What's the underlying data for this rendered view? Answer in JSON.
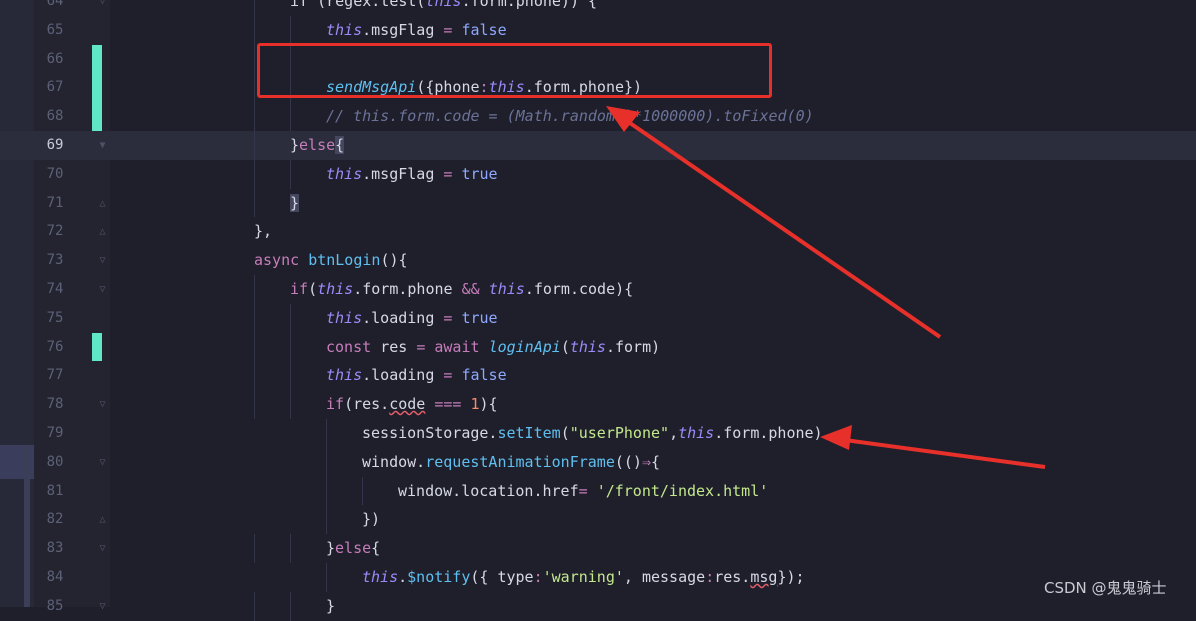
{
  "editor": {
    "current_line": 69,
    "lines": [
      {
        "no": "64",
        "segments": [
          {
            "t": "if (regex.test(",
            "c": "prop"
          },
          {
            "t": "this",
            "c": "this"
          },
          {
            "t": ".form.phone)) {",
            "c": "prop"
          }
        ]
      },
      {
        "no": "65",
        "segments": [
          {
            "t": "this",
            "c": "this"
          },
          {
            "t": ".msgFlag ",
            "c": "prop"
          },
          {
            "t": "=",
            "c": "op"
          },
          {
            "t": " false",
            "c": "bool"
          }
        ]
      },
      {
        "no": "66",
        "segments": []
      },
      {
        "no": "67",
        "segments": [
          {
            "t": "sendMsgApi",
            "c": "fn-it"
          },
          {
            "t": "({phone",
            "c": "prop"
          },
          {
            "t": ":",
            "c": "op"
          },
          {
            "t": "this",
            "c": "this"
          },
          {
            "t": ".form.phone})",
            "c": "prop"
          }
        ]
      },
      {
        "no": "68",
        "segments": [
          {
            "t": "// this.form.code = (Math.random()*1000000).toFixed(0)",
            "c": "comment"
          }
        ]
      },
      {
        "no": "69",
        "segments": [
          {
            "t": "}",
            "c": "prop"
          },
          {
            "t": "else",
            "c": "kw"
          },
          {
            "t": "{",
            "c": "prop brace-hl"
          }
        ]
      },
      {
        "no": "70",
        "segments": [
          {
            "t": "this",
            "c": "this"
          },
          {
            "t": ".msgFlag ",
            "c": "prop"
          },
          {
            "t": "=",
            "c": "op"
          },
          {
            "t": " true",
            "c": "bool"
          }
        ]
      },
      {
        "no": "71",
        "segments": [
          {
            "t": "}",
            "c": "prop brace-hl"
          }
        ]
      },
      {
        "no": "72",
        "segments": [
          {
            "t": "},",
            "c": "prop"
          }
        ]
      },
      {
        "no": "73",
        "segments": [
          {
            "t": "async ",
            "c": "kw"
          },
          {
            "t": "btnLogin",
            "c": "fn"
          },
          {
            "t": "(){",
            "c": "prop"
          }
        ]
      },
      {
        "no": "74",
        "segments": [
          {
            "t": "if",
            "c": "kw"
          },
          {
            "t": "(",
            "c": "prop"
          },
          {
            "t": "this",
            "c": "this"
          },
          {
            "t": ".form.phone ",
            "c": "prop"
          },
          {
            "t": "&&",
            "c": "op"
          },
          {
            "t": " ",
            "c": "prop"
          },
          {
            "t": "this",
            "c": "this"
          },
          {
            "t": ".form.code){",
            "c": "prop"
          }
        ]
      },
      {
        "no": "75",
        "segments": [
          {
            "t": "this",
            "c": "this"
          },
          {
            "t": ".loading ",
            "c": "prop"
          },
          {
            "t": "=",
            "c": "op"
          },
          {
            "t": " true",
            "c": "bool"
          }
        ]
      },
      {
        "no": "76",
        "segments": [
          {
            "t": "const ",
            "c": "kw"
          },
          {
            "t": "res ",
            "c": "prop"
          },
          {
            "t": "=",
            "c": "op"
          },
          {
            "t": " await ",
            "c": "kw"
          },
          {
            "t": "loginApi",
            "c": "fn-it"
          },
          {
            "t": "(",
            "c": "prop"
          },
          {
            "t": "this",
            "c": "this"
          },
          {
            "t": ".form)",
            "c": "prop"
          }
        ]
      },
      {
        "no": "77",
        "segments": [
          {
            "t": "this",
            "c": "this"
          },
          {
            "t": ".loading ",
            "c": "prop"
          },
          {
            "t": "=",
            "c": "op"
          },
          {
            "t": " false",
            "c": "bool"
          }
        ]
      },
      {
        "no": "78",
        "segments": [
          {
            "t": "if",
            "c": "kw"
          },
          {
            "t": "(res.",
            "c": "prop"
          },
          {
            "t": "code",
            "c": "prop squiggle"
          },
          {
            "t": " ",
            "c": "prop"
          },
          {
            "t": "===",
            "c": "op"
          },
          {
            "t": " ",
            "c": "prop"
          },
          {
            "t": "1",
            "c": "num"
          },
          {
            "t": "){",
            "c": "prop"
          }
        ]
      },
      {
        "no": "79",
        "segments": [
          {
            "t": "sessionStorage.",
            "c": "prop"
          },
          {
            "t": "setItem",
            "c": "fn"
          },
          {
            "t": "(",
            "c": "prop"
          },
          {
            "t": "\"userPhone\"",
            "c": "str"
          },
          {
            "t": ",",
            "c": "prop"
          },
          {
            "t": "this",
            "c": "this"
          },
          {
            "t": ".form.phone)",
            "c": "prop"
          }
        ]
      },
      {
        "no": "80",
        "segments": [
          {
            "t": "window.",
            "c": "prop"
          },
          {
            "t": "requestAnimationFrame",
            "c": "fn"
          },
          {
            "t": "(()",
            "c": "prop"
          },
          {
            "t": "⇒",
            "c": "op"
          },
          {
            "t": "{",
            "c": "prop"
          }
        ]
      },
      {
        "no": "81",
        "segments": [
          {
            "t": "window.location.href",
            "c": "prop"
          },
          {
            "t": "=",
            "c": "op"
          },
          {
            "t": " ",
            "c": "prop"
          },
          {
            "t": "'/front/index.html'",
            "c": "str"
          }
        ]
      },
      {
        "no": "82",
        "segments": [
          {
            "t": "})",
            "c": "prop"
          }
        ]
      },
      {
        "no": "83",
        "segments": [
          {
            "t": "}",
            "c": "prop"
          },
          {
            "t": "else",
            "c": "kw"
          },
          {
            "t": "{",
            "c": "prop"
          }
        ]
      },
      {
        "no": "84",
        "segments": [
          {
            "t": "this",
            "c": "this"
          },
          {
            "t": ".",
            "c": "prop"
          },
          {
            "t": "$notify",
            "c": "fn"
          },
          {
            "t": "({ type",
            "c": "prop"
          },
          {
            "t": ":",
            "c": "op"
          },
          {
            "t": "'warning'",
            "c": "str"
          },
          {
            "t": ", message",
            "c": "prop"
          },
          {
            "t": ":",
            "c": "op"
          },
          {
            "t": "res.",
            "c": "prop"
          },
          {
            "t": "msg",
            "c": "prop squiggle"
          },
          {
            "t": "});",
            "c": "prop"
          }
        ]
      },
      {
        "no": "85",
        "segments": [
          {
            "t": "}",
            "c": "prop"
          }
        ]
      }
    ]
  },
  "watermark": "CSDN @鬼鬼骑士",
  "colors": {
    "annotation": "#e8302b",
    "change_marker": "#5fe7c6",
    "background": "#1e1f2a"
  }
}
